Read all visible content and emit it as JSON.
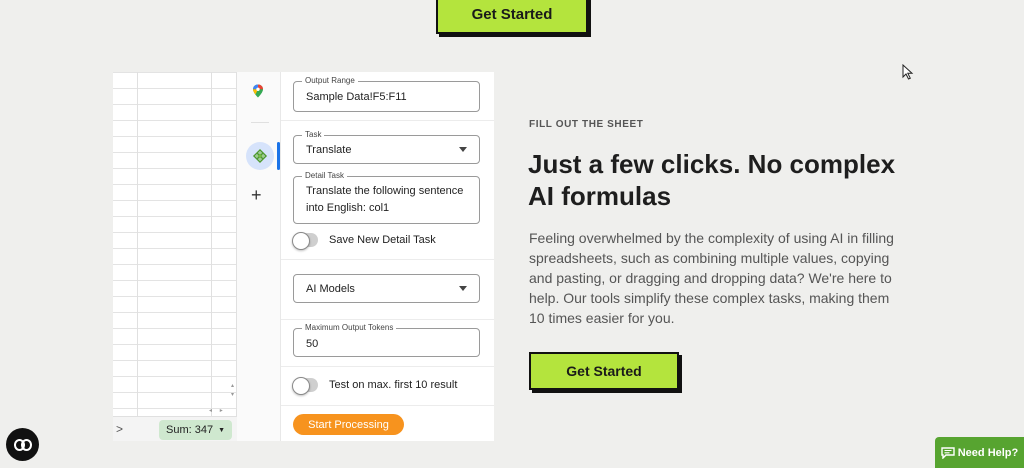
{
  "top_cta": {
    "label": "Get Started"
  },
  "sheet": {
    "sum_label": "Sum: 347",
    "nav_arrow": ">",
    "scroll_up": "▴",
    "scroll_down": "▾",
    "scroll_left": "◂",
    "scroll_right": "▸"
  },
  "sidebar": {
    "add_icon": "+"
  },
  "panel": {
    "output_range": {
      "legend": "Output Range",
      "value": "Sample Data!F5:F11"
    },
    "task": {
      "legend": "Task",
      "value": "Translate"
    },
    "detail_task": {
      "legend": "Detail Task",
      "line1": "Translate the following sentence",
      "line2": "into English: col1"
    },
    "save_toggle_label": "Save New Detail Task",
    "ai_models": {
      "value": "AI Models"
    },
    "max_tokens": {
      "legend": "Maximum Output Tokens",
      "value": "50"
    },
    "test_toggle_label": "Test on max. first 10 result",
    "start_button": "Start Processing"
  },
  "content": {
    "eyebrow": "FILL OUT THE SHEET",
    "headline_line1": "Just a few clicks. No complex",
    "headline_line2": "AI formulas",
    "description": "Feeling overwhelmed by the complexity of using AI in filling spreadsheets, such as combining multiple values, copying and pasting, or dragging and dropping data? We're here to help. Our tools simplify these complex tasks, making them 10 times easier for you.",
    "cta": "Get Started"
  },
  "help_button": {
    "label": "Need Help?"
  },
  "colors": {
    "accent_green": "#b4e43d",
    "start_orange": "#f7931e",
    "help_green": "#57a430"
  },
  "icons": [
    "maps-pin-icon",
    "extension-icon",
    "plus-icon",
    "chat-icon",
    "cursor-icon",
    "caret-down-icon"
  ]
}
